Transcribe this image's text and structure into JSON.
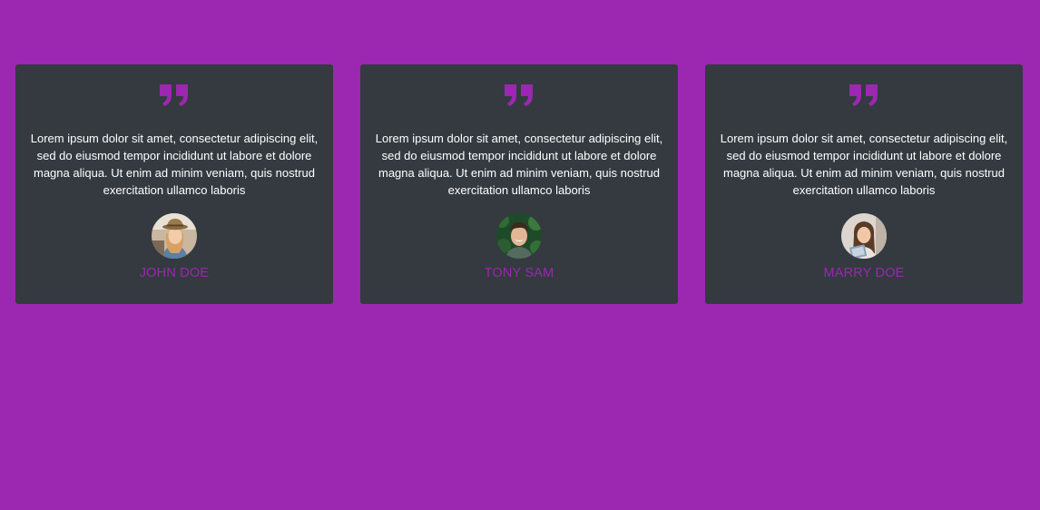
{
  "theme": {
    "background": "#9c27b0",
    "card_background": "#343a40",
    "accent": "#9c27b0",
    "text": "#ffffff"
  },
  "testimonials": [
    {
      "quote_icon": "quote-icon",
      "text": "Lorem ipsum dolor sit amet, consectetur adipiscing elit, sed do eiusmod tempor incididunt ut labore et dolore magna aliqua. Ut enim ad minim veniam, quis nostrud exercitation ullamco laboris",
      "avatar": "avatar-woman-hat",
      "name": "JOHN DOE"
    },
    {
      "quote_icon": "quote-icon",
      "text": "Lorem ipsum dolor sit amet, consectetur adipiscing elit, sed do eiusmod tempor incididunt ut labore et dolore magna aliqua. Ut enim ad minim veniam, quis nostrud exercitation ullamco laboris",
      "avatar": "avatar-man-smiling",
      "name": "TONY SAM"
    },
    {
      "quote_icon": "quote-icon",
      "text": "Lorem ipsum dolor sit amet, consectetur adipiscing elit, sed do eiusmod tempor incididunt ut labore et dolore magna aliqua. Ut enim ad minim veniam, quis nostrud exercitation ullamco laboris",
      "avatar": "avatar-woman-book",
      "name": "MARRY DOE"
    }
  ]
}
